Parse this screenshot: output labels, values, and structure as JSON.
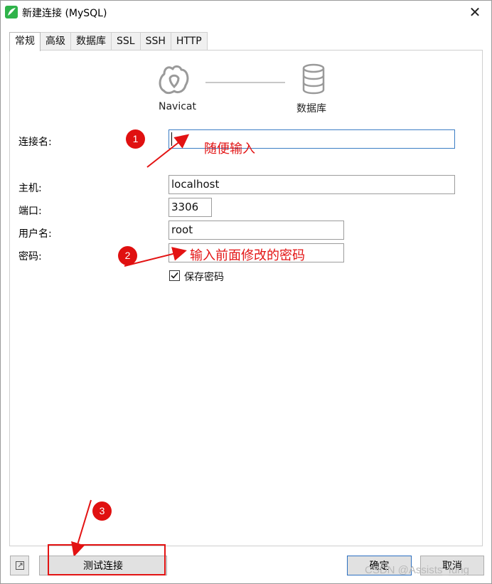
{
  "window": {
    "title": "新建连接 (MySQL)",
    "close_glyph": "✕"
  },
  "tabs": [
    {
      "label": "常规",
      "active": true
    },
    {
      "label": "高级",
      "active": false
    },
    {
      "label": "数据库",
      "active": false
    },
    {
      "label": "SSL",
      "active": false
    },
    {
      "label": "SSH",
      "active": false
    },
    {
      "label": "HTTP",
      "active": false
    }
  ],
  "header": {
    "left_icon": "navicat-icon",
    "left_label": "Navicat",
    "right_icon": "database-icon",
    "right_label": "数据库"
  },
  "form": {
    "connection_name": {
      "label": "连接名:",
      "value": ""
    },
    "host": {
      "label": "主机:",
      "value": "localhost"
    },
    "port": {
      "label": "端口:",
      "value": "3306"
    },
    "username": {
      "label": "用户名:",
      "value": "root"
    },
    "password": {
      "label": "密码:",
      "value": ""
    },
    "save_password": {
      "label": "保存密码",
      "checked": true
    }
  },
  "annotations": {
    "step1_badge": "1",
    "step1_text": "随便输入",
    "step2_badge": "2",
    "step2_text": "输入前面修改的密码",
    "step3_badge": "3",
    "color": "#e31313"
  },
  "buttons": {
    "test_connection": "测试连接",
    "ok": "确定",
    "cancel": "取消"
  },
  "watermark": "CSDN @Assists_fung"
}
